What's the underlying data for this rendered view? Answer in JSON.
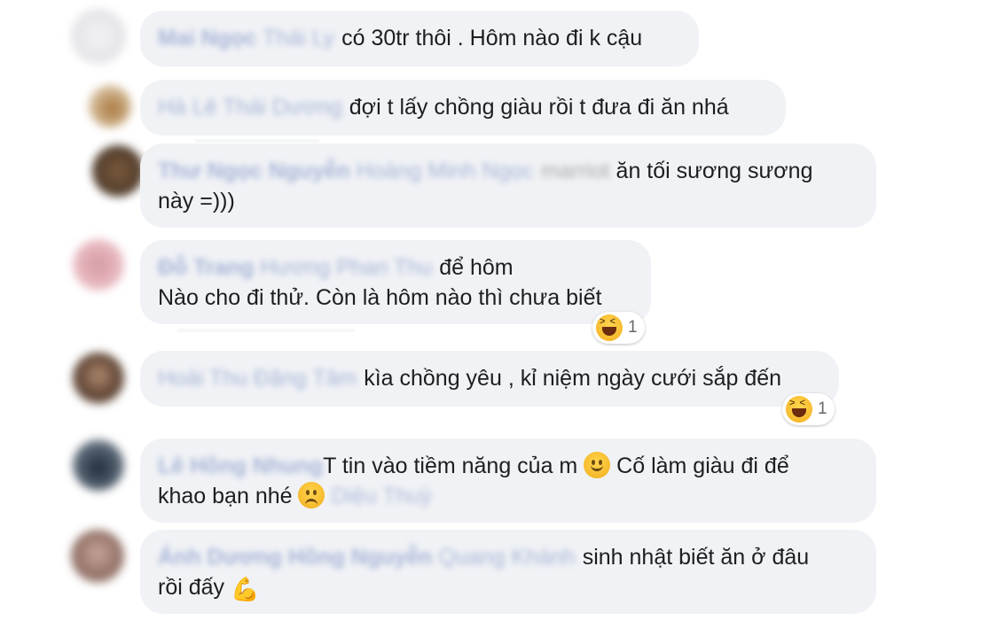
{
  "comments": [
    {
      "name_bold": "Mai Ngọc",
      "name_light": "Thái Ly",
      "text_lines": [
        "có 30tr thôi . Hôm nào đi k cậu"
      ]
    },
    {
      "name_bold": "",
      "name_light": "Hà Lê Thái Dương",
      "text_lines": [
        "đợi t lấy chồng giàu rồi t đưa đi ăn nhá"
      ]
    },
    {
      "name_bold": "Thư Ngọc Nguyễn",
      "name_light": "Hoàng Minh Ngọc",
      "tag_gray": "marriot",
      "text_lines": [
        "ăn tối sương sương",
        "này =)))"
      ]
    },
    {
      "name_bold": "Đỗ Trang",
      "name_light": "Hương Phan Thu",
      "text_lines": [
        "để hôm",
        "Nào cho đi thử. Còn là hôm nào thì chưa biết"
      ],
      "reaction_count": "1"
    },
    {
      "name_bold": "",
      "name_light": "Hoài Thu Đặng Tâm",
      "text_lines": [
        "kìa chồng yêu , kỉ niệm ngày cưới sắp đến"
      ],
      "reaction_count": "1"
    },
    {
      "name_bold": "Lê Hồng Nhung",
      "name_light": "",
      "text_lines": [
        "T tin vào tiềm năng của m",
        "Cố làm giàu đi để",
        "khao bạn nhé"
      ],
      "tag": "Diệu Thuỳ"
    },
    {
      "name_bold": "Ánh Dương Hồng Nguyễn",
      "name_light": "Quang Khánh",
      "text_lines": [
        "sinh nhật biết ăn ở đâu",
        "rồi đấy"
      ]
    }
  ],
  "colors": {
    "bubble": "#f0f2f5",
    "name": "#6d83c0",
    "text": "#1c1e21"
  },
  "icons": [
    "slightly-smiling-face-icon",
    "frowning-face-icon",
    "flexed-biceps-icon",
    "haha-reaction-icon"
  ]
}
